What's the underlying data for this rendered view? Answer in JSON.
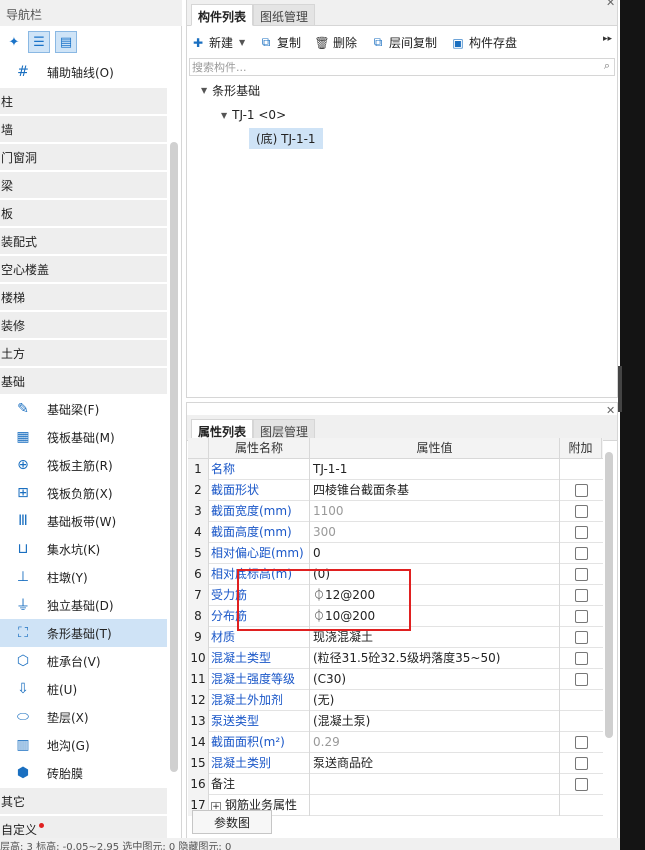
{
  "nav": {
    "title": "导航栏",
    "top_item": {
      "label": "辅助轴线(O)",
      "icon": "grid-icon"
    },
    "categories": [
      "柱",
      "墙",
      "门窗洞",
      "梁",
      "板",
      "装配式",
      "空心楼盖",
      "楼梯",
      "装修",
      "土方",
      "基础"
    ],
    "foundation_items": [
      {
        "label": "基础梁(F)",
        "icon": "pencil-beam-icon"
      },
      {
        "label": "筏板基础(M)",
        "icon": "raft-grid-icon"
      },
      {
        "label": "筏板主筋(R)",
        "icon": "raft-main-rebar-icon"
      },
      {
        "label": "筏板负筋(X)",
        "icon": "raft-neg-rebar-icon"
      },
      {
        "label": "基础板带(W)",
        "icon": "slab-strip-icon"
      },
      {
        "label": "集水坑(K)",
        "icon": "sump-icon"
      },
      {
        "label": "柱墩(Y)",
        "icon": "column-pier-icon"
      },
      {
        "label": "独立基础(D)",
        "icon": "isolated-footing-icon"
      },
      {
        "label": "条形基础(T)",
        "icon": "strip-footing-icon",
        "selected": true
      },
      {
        "label": "桩承台(V)",
        "icon": "pile-cap-icon"
      },
      {
        "label": "桩(U)",
        "icon": "pile-icon"
      },
      {
        "label": "垫层(X)",
        "icon": "cushion-icon"
      },
      {
        "label": "地沟(G)",
        "icon": "trench-icon"
      },
      {
        "label": "砖胎膜",
        "icon": "brick-mold-icon"
      }
    ],
    "bottom_categories": [
      "其它",
      "自定义"
    ]
  },
  "component_panel": {
    "tabs": [
      "构件列表",
      "图纸管理"
    ],
    "toolbar": {
      "new": "新建",
      "copy": "复制",
      "delete": "删除",
      "floor_copy": "层间复制",
      "save": "构件存盘"
    },
    "search_placeholder": "搜索构件...",
    "tree": {
      "root": "条形基础",
      "child": "TJ-1 <0>",
      "leaf": "(底) TJ-1-1"
    }
  },
  "property_panel": {
    "tabs": [
      "属性列表",
      "图层管理"
    ],
    "columns": [
      "属性名称",
      "属性值",
      "附加"
    ],
    "rows": [
      {
        "n": "1",
        "name": "名称",
        "value": "TJ-1-1",
        "checkbox": false
      },
      {
        "n": "2",
        "name": "截面形状",
        "value": "四棱锥台截面条基",
        "checkbox": true
      },
      {
        "n": "3",
        "name": "截面宽度(mm)",
        "value": "1100",
        "checkbox": true,
        "gray": true
      },
      {
        "n": "4",
        "name": "截面高度(mm)",
        "value": "300",
        "checkbox": true,
        "gray": true
      },
      {
        "n": "5",
        "name": "相对偏心距(mm)",
        "value": "0",
        "checkbox": true
      },
      {
        "n": "6",
        "name": "相对底标高(m)",
        "value": "(0)",
        "checkbox": true
      },
      {
        "n": "7",
        "name": "受力筋",
        "value": "⏀12@200",
        "checkbox": true
      },
      {
        "n": "8",
        "name": "分布筋",
        "value": "⏀10@200",
        "checkbox": true
      },
      {
        "n": "9",
        "name": "材质",
        "value": "现浇混凝土",
        "checkbox": true
      },
      {
        "n": "10",
        "name": "混凝土类型",
        "value": "(粒径31.5砼32.5级坍落度35~50)",
        "checkbox": true
      },
      {
        "n": "11",
        "name": "混凝土强度等级",
        "value": "(C30)",
        "checkbox": true
      },
      {
        "n": "12",
        "name": "混凝土外加剂",
        "value": "(无)",
        "checkbox": false
      },
      {
        "n": "13",
        "name": "泵送类型",
        "value": "(混凝土泵)",
        "checkbox": false
      },
      {
        "n": "14",
        "name": "截面面积(m²)",
        "value": "0.29",
        "checkbox": true,
        "gray": true
      },
      {
        "n": "15",
        "name": "混凝土类别",
        "value": "泵送商品砼",
        "checkbox": true
      },
      {
        "n": "16",
        "name": "备注",
        "value": "",
        "checkbox": true,
        "black": true
      },
      {
        "n": "17",
        "name": "钢筋业务属性",
        "value": "",
        "checkbox": false,
        "black": true
      }
    ],
    "param_button": "参数图"
  },
  "status_bar": "层高: 3    标高: -0.05~2.95    选中图元: 0    隐藏图元: 0",
  "colors": {
    "accent": "#1a6fc0",
    "selection": "#cfe3f6",
    "highlight_box": "#e02020",
    "prop_name": "#1a57c8"
  }
}
